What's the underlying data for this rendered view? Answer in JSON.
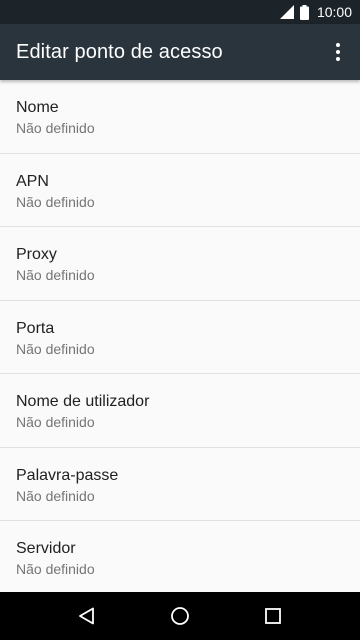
{
  "status_bar": {
    "time": "10:00",
    "icons": [
      "signal-icon",
      "battery-icon"
    ]
  },
  "app_bar": {
    "title": "Editar ponto de acesso",
    "overflow_icon": "more-vert-icon"
  },
  "list": {
    "items": [
      {
        "title": "Nome",
        "value": "Não definido"
      },
      {
        "title": "APN",
        "value": "Não definido"
      },
      {
        "title": "Proxy",
        "value": "Não definido"
      },
      {
        "title": "Porta",
        "value": "Não definido"
      },
      {
        "title": "Nome de utilizador",
        "value": "Não definido"
      },
      {
        "title": "Palavra-passe",
        "value": "Não definido"
      },
      {
        "title": "Servidor",
        "value": "Não definido"
      }
    ]
  },
  "nav_bar": {
    "icons": [
      "back-icon",
      "home-icon",
      "recents-icon"
    ]
  },
  "colors": {
    "status_bar": "#1c2329",
    "app_bar": "#2a343c",
    "background": "#fafafa",
    "divider": "#e0e0e0",
    "primary_text": "#212121",
    "secondary_text": "#757575"
  }
}
